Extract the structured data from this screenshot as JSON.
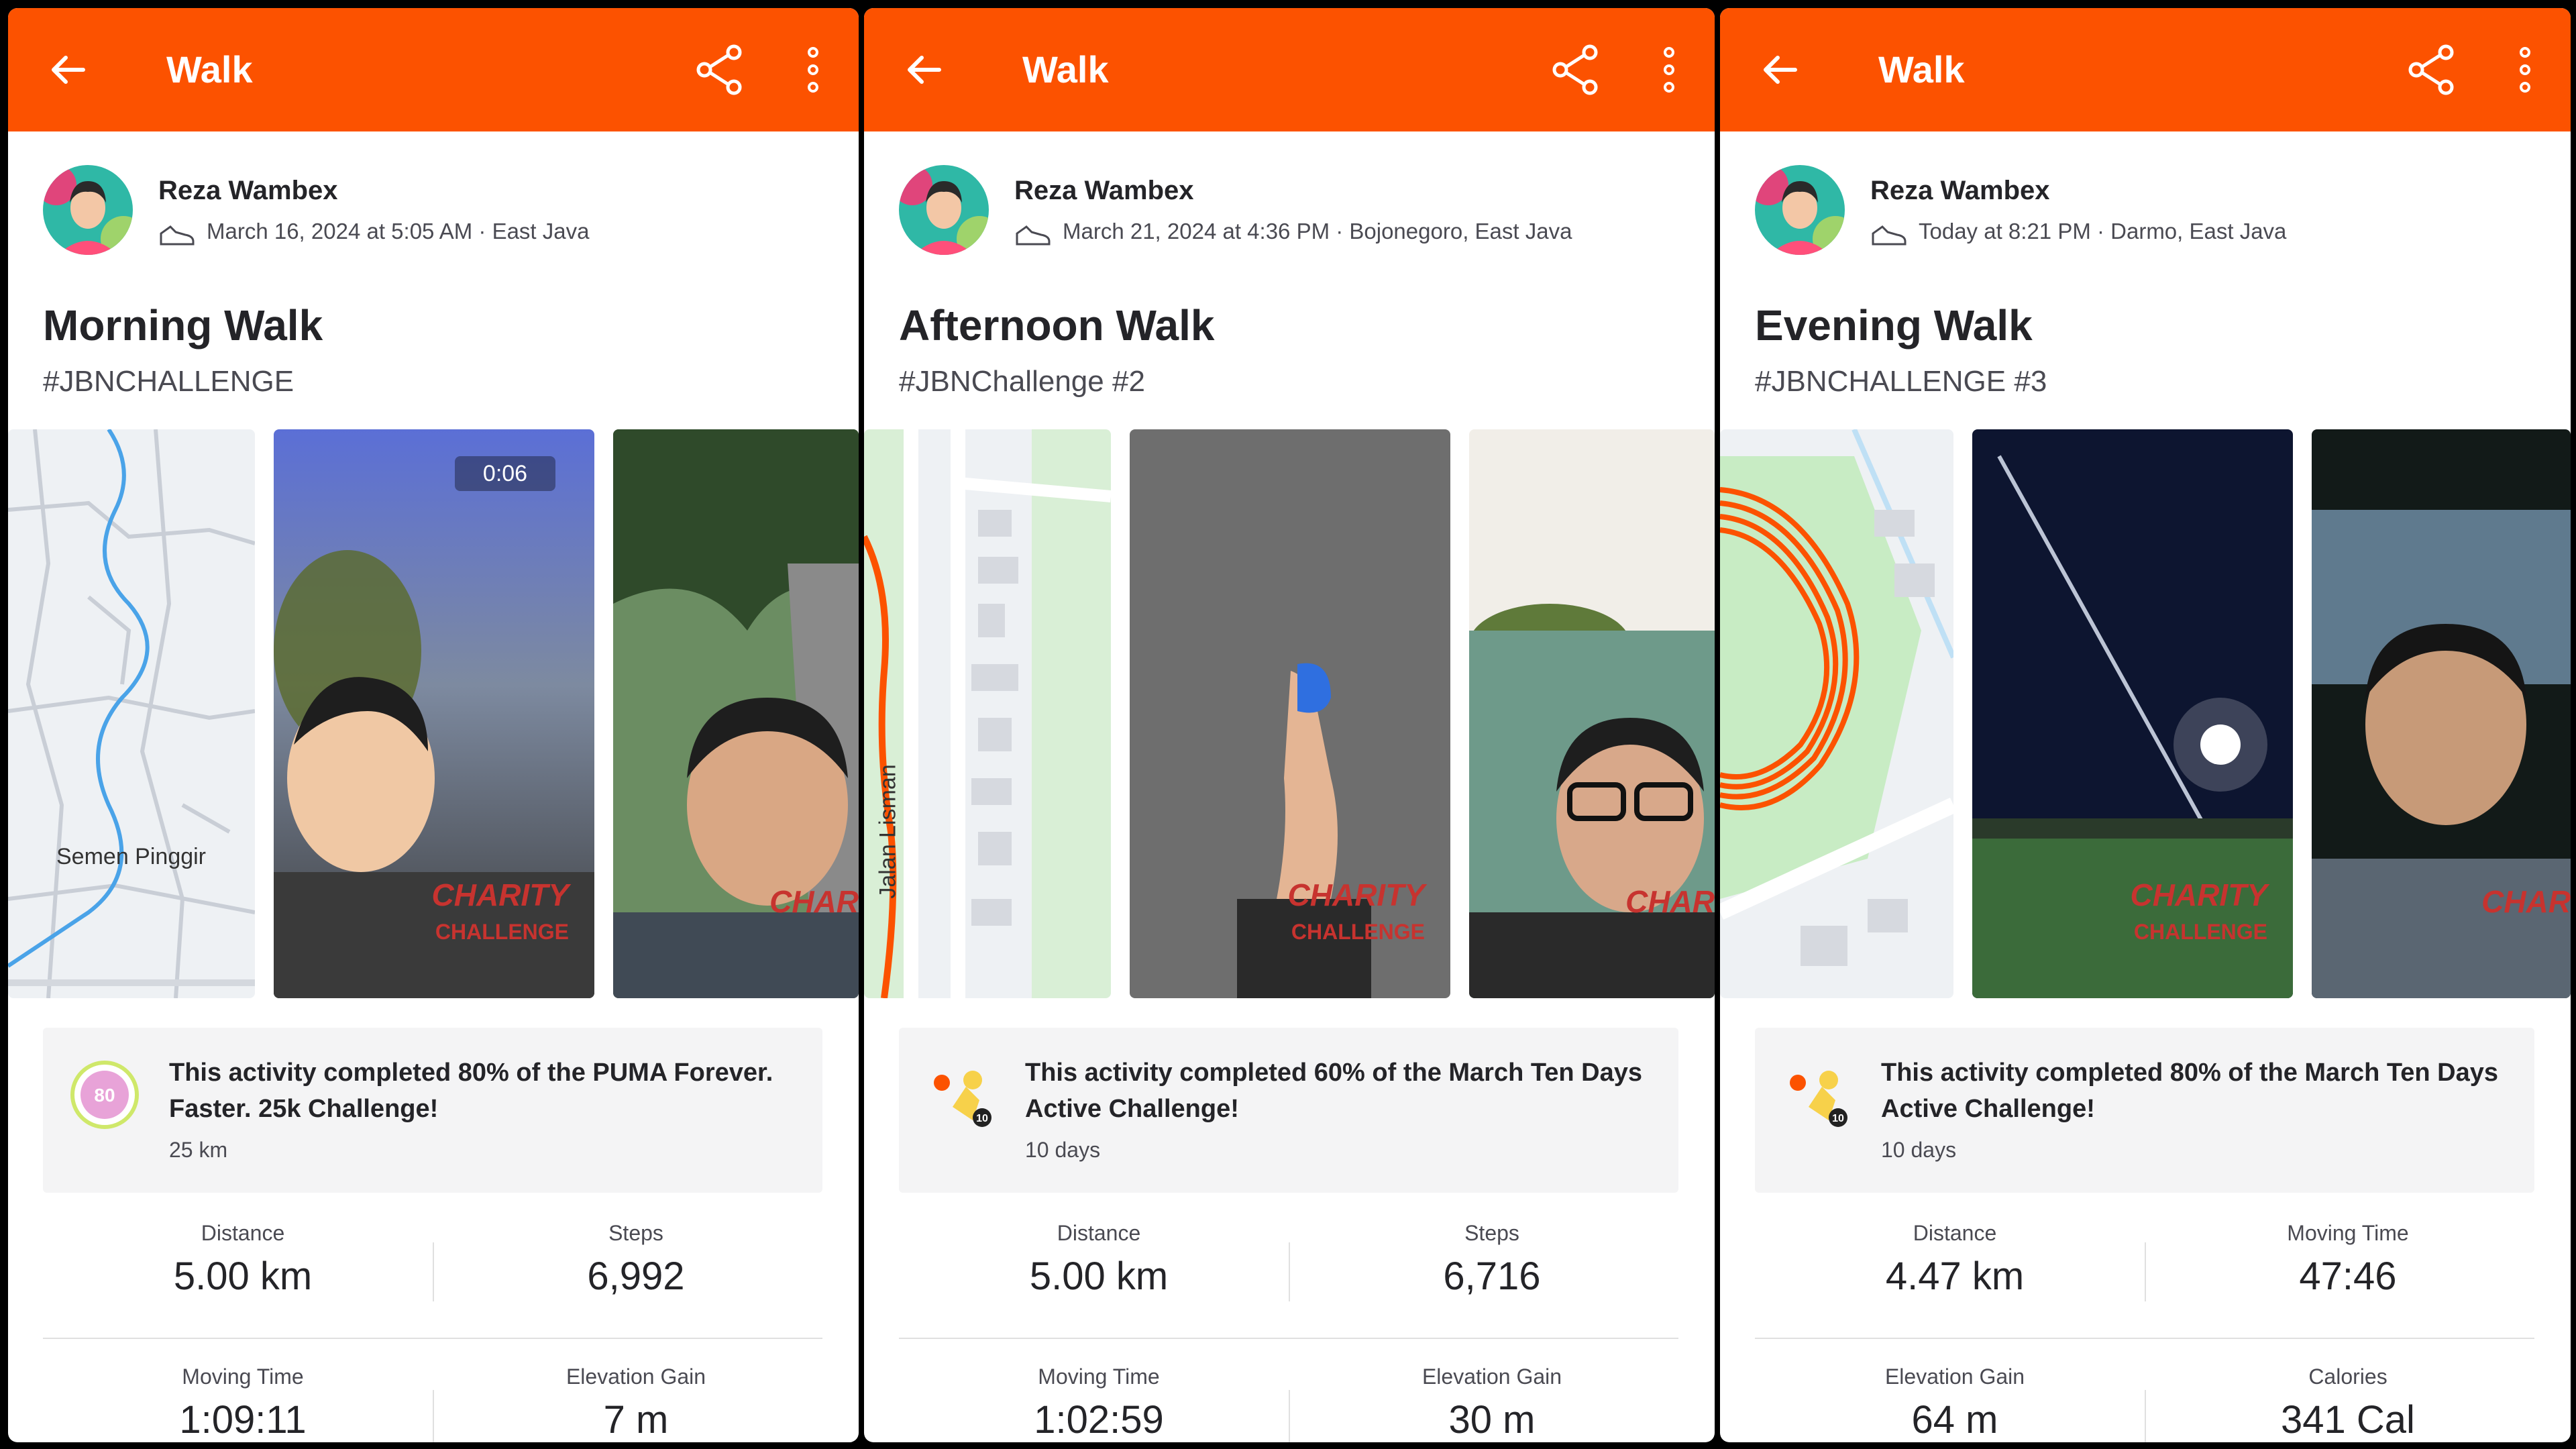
{
  "colors": {
    "brand": "#fc5200",
    "route": "#fc5200"
  },
  "panels": [
    {
      "header_title": "Walk",
      "athlete": "Reza Wambex",
      "meta": "March 16, 2024 at 5:05 AM · East Java",
      "title": "Morning Walk",
      "description": "#JBNCHALLENGE",
      "media": {
        "map_label": "Semen Pinggir",
        "video_duration": "0:06"
      },
      "challenge": {
        "badge_icon": "puma-80-badge",
        "text": "This activity completed 80% of the PUMA Forever. Faster. 25k Challenge!",
        "sub": "25 km"
      },
      "stats": [
        {
          "label": "Distance",
          "value": "5.00 km"
        },
        {
          "label": "Steps",
          "value": "6,992"
        },
        {
          "label": "Moving Time",
          "value": "1:09:11"
        },
        {
          "label": "Elevation Gain",
          "value": "7 m"
        }
      ]
    },
    {
      "header_title": "Walk",
      "athlete": "Reza Wambex",
      "meta": "March 21, 2024 at 4:36 PM · Bojonegoro, East Java",
      "title": "Afternoon Walk",
      "description": "#JBNChallenge #2",
      "media": {
        "map_label": "Jalan Lisman",
        "video_duration": ""
      },
      "challenge": {
        "badge_icon": "march-ten-days-badge",
        "text": "This activity completed 60% of the March Ten Days Active Challenge!",
        "sub": "10 days"
      },
      "stats": [
        {
          "label": "Distance",
          "value": "5.00 km"
        },
        {
          "label": "Steps",
          "value": "6,716"
        },
        {
          "label": "Moving Time",
          "value": "1:02:59"
        },
        {
          "label": "Elevation Gain",
          "value": "30 m"
        }
      ]
    },
    {
      "header_title": "Walk",
      "athlete": "Reza Wambex",
      "meta": "Today at 8:21 PM · Darmo, East Java",
      "title": "Evening Walk",
      "description": "#JBNCHALLENGE #3",
      "media": {
        "map_label": "",
        "video_duration": ""
      },
      "challenge": {
        "badge_icon": "march-ten-days-badge",
        "text": "This activity completed 80% of the March Ten Days Active Challenge!",
        "sub": "10 days"
      },
      "stats": [
        {
          "label": "Distance",
          "value": "4.47 km"
        },
        {
          "label": "Moving Time",
          "value": "47:46"
        },
        {
          "label": "Elevation Gain",
          "value": "64 m"
        },
        {
          "label": "Calories",
          "value": "341 Cal"
        }
      ]
    }
  ]
}
